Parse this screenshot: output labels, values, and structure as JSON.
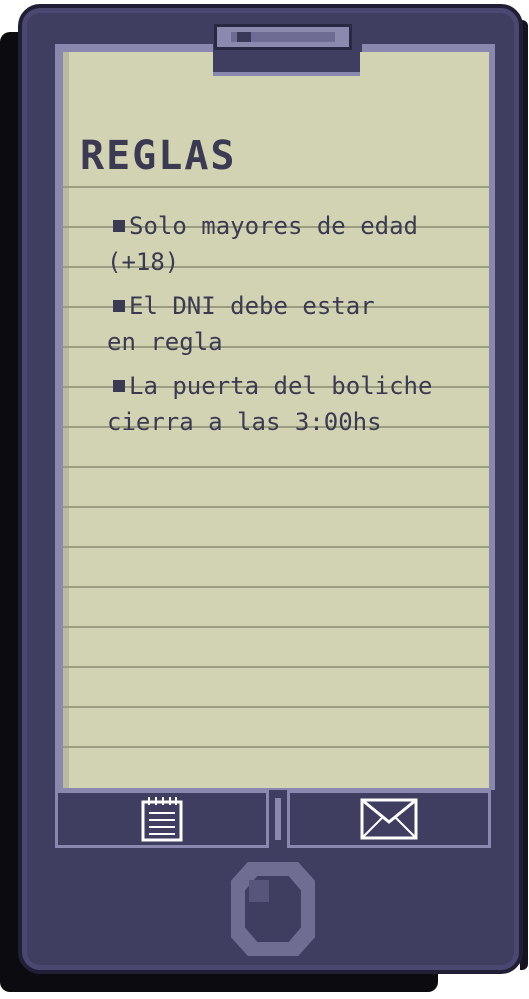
{
  "screen": {
    "title": "REGLAS",
    "rules": [
      {
        "line1": "Solo mayores de edad",
        "line2": "(+18)"
      },
      {
        "line1": "El DNI debe estar",
        "line2": "en regla"
      },
      {
        "line1": "La puerta del boliche",
        "line2": "cierra a las 3:00hs"
      }
    ]
  },
  "dock": {
    "buttons": [
      {
        "icon": "notepad-icon"
      },
      {
        "icon": "envelope-icon"
      }
    ]
  },
  "colors": {
    "phone_body": "#3f3d60",
    "screen_paper": "#d2d3b2",
    "text": "#3b3a52",
    "frame_light": "#8a88ae"
  }
}
